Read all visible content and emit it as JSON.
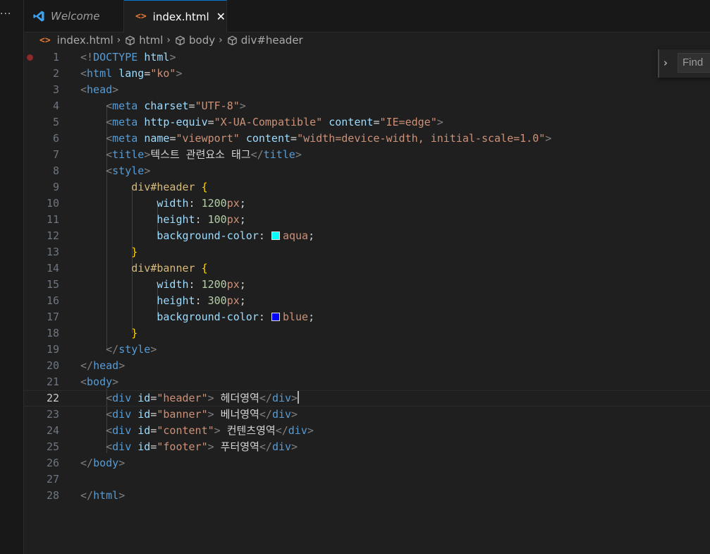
{
  "colors": {
    "accent": "#0078d4",
    "html_icon": "#e37933",
    "vscode_logo": "#3ca3ee",
    "breakpoint": "#8c2a2a"
  },
  "activity_bar": {
    "more_label": "···"
  },
  "tabs": [
    {
      "label": "Welcome",
      "icon": "vscode-logo-icon",
      "active": false
    },
    {
      "label": "index.html",
      "icon": "html-file-icon",
      "active": true,
      "close": "✕"
    }
  ],
  "breadcrumb": {
    "items": [
      "index.html",
      "html",
      "body",
      "div#header"
    ],
    "separator": "›"
  },
  "find_widget": {
    "placeholder": "Find",
    "toggle": "›"
  },
  "editor": {
    "current_line": 22,
    "line_numbers": [
      "1",
      "2",
      "3",
      "4",
      "5",
      "6",
      "7",
      "8",
      "9",
      "10",
      "11",
      "12",
      "13",
      "14",
      "15",
      "16",
      "17",
      "18",
      "19",
      "20",
      "21",
      "22",
      "23",
      "24",
      "25",
      "26",
      "27",
      "28"
    ],
    "lines": [
      "<!DOCTYPE html>",
      "<html lang=\"ko\">",
      "<head>",
      "    <meta charset=\"UTF-8\">",
      "    <meta http-equiv=\"X-UA-Compatible\" content=\"IE=edge\">",
      "    <meta name=\"viewport\" content=\"width=device-width, initial-scale=1.0\">",
      "    <title>텍스트 관련요소 태그</title>",
      "    <style>",
      "        div#header {",
      "            width: 1200px;",
      "            height: 100px;",
      "            background-color: aqua;",
      "        }",
      "        div#banner {",
      "            width: 1200px;",
      "            height: 300px;",
      "            background-color: blue;",
      "        }",
      "    </style>",
      "</head>",
      "<body>",
      "    <div id=\"header\"> 헤더영역</div>",
      "    <div id=\"banner\"> 베너영역</div>",
      "    <div id=\"content\"> 컨텐츠영역</div>",
      "    <div id=\"footer\"> 푸터영역</div>",
      "</body>",
      "",
      "</html>"
    ],
    "swatches": {
      "12": "#00ffff",
      "17": "#0000ff"
    }
  }
}
